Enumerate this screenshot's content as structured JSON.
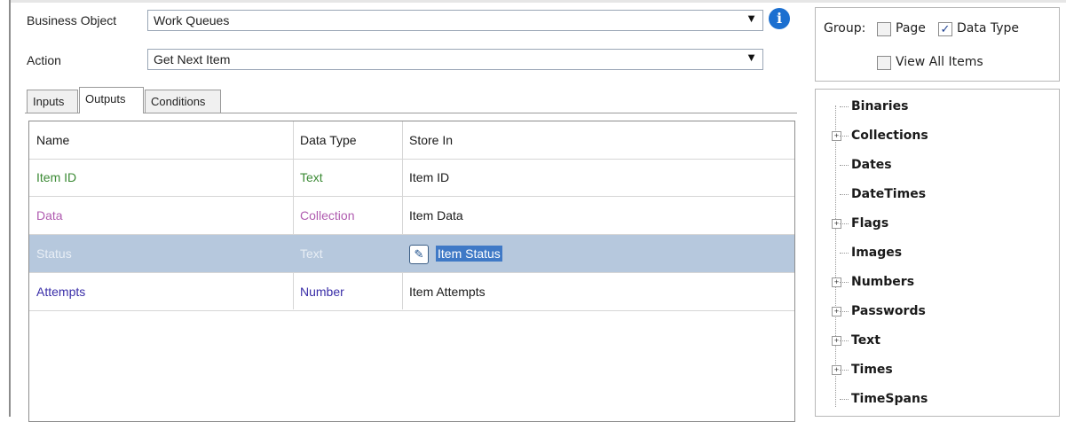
{
  "header": {
    "business_object_label": "Business Object",
    "business_object_value": "Work Queues",
    "action_label": "Action",
    "action_value": "Get Next Item",
    "dropdown_glyph": "▼",
    "info_glyph": "i"
  },
  "tabs": [
    {
      "label": "Inputs"
    },
    {
      "label": "Outputs"
    },
    {
      "label": "Conditions"
    }
  ],
  "active_tab": "Outputs",
  "table": {
    "columns": [
      "Name",
      "Data Type",
      "Store In"
    ],
    "rows": [
      {
        "name": "Item ID",
        "type": "Text",
        "store": "Item ID",
        "color": "#3b8a34"
      },
      {
        "name": "Data",
        "type": "Collection",
        "store": "Item Data",
        "color": "#b05cb0"
      },
      {
        "name": "Status",
        "type": "Text",
        "store": "Item Status",
        "color": "#ffffff",
        "selected": true
      },
      {
        "name": "Attempts",
        "type": "Number",
        "store": "Item Attempts",
        "color": "#3a2ea8"
      }
    ]
  },
  "group": {
    "label": "Group:",
    "page_label": "Page",
    "page_checked": false,
    "data_type_label": "Data Type",
    "data_type_checked": true,
    "view_all_label": "View All Items",
    "view_all_checked": false
  },
  "tree": {
    "items": [
      {
        "label": "Binaries",
        "expandable": false
      },
      {
        "label": "Collections",
        "expandable": true
      },
      {
        "label": "Dates",
        "expandable": false
      },
      {
        "label": "DateTimes",
        "expandable": false
      },
      {
        "label": "Flags",
        "expandable": true
      },
      {
        "label": "Images",
        "expandable": false
      },
      {
        "label": "Numbers",
        "expandable": true
      },
      {
        "label": "Passwords",
        "expandable": true
      },
      {
        "label": "Text",
        "expandable": true
      },
      {
        "label": "Times",
        "expandable": true
      },
      {
        "label": "TimeSpans",
        "expandable": false
      }
    ]
  }
}
